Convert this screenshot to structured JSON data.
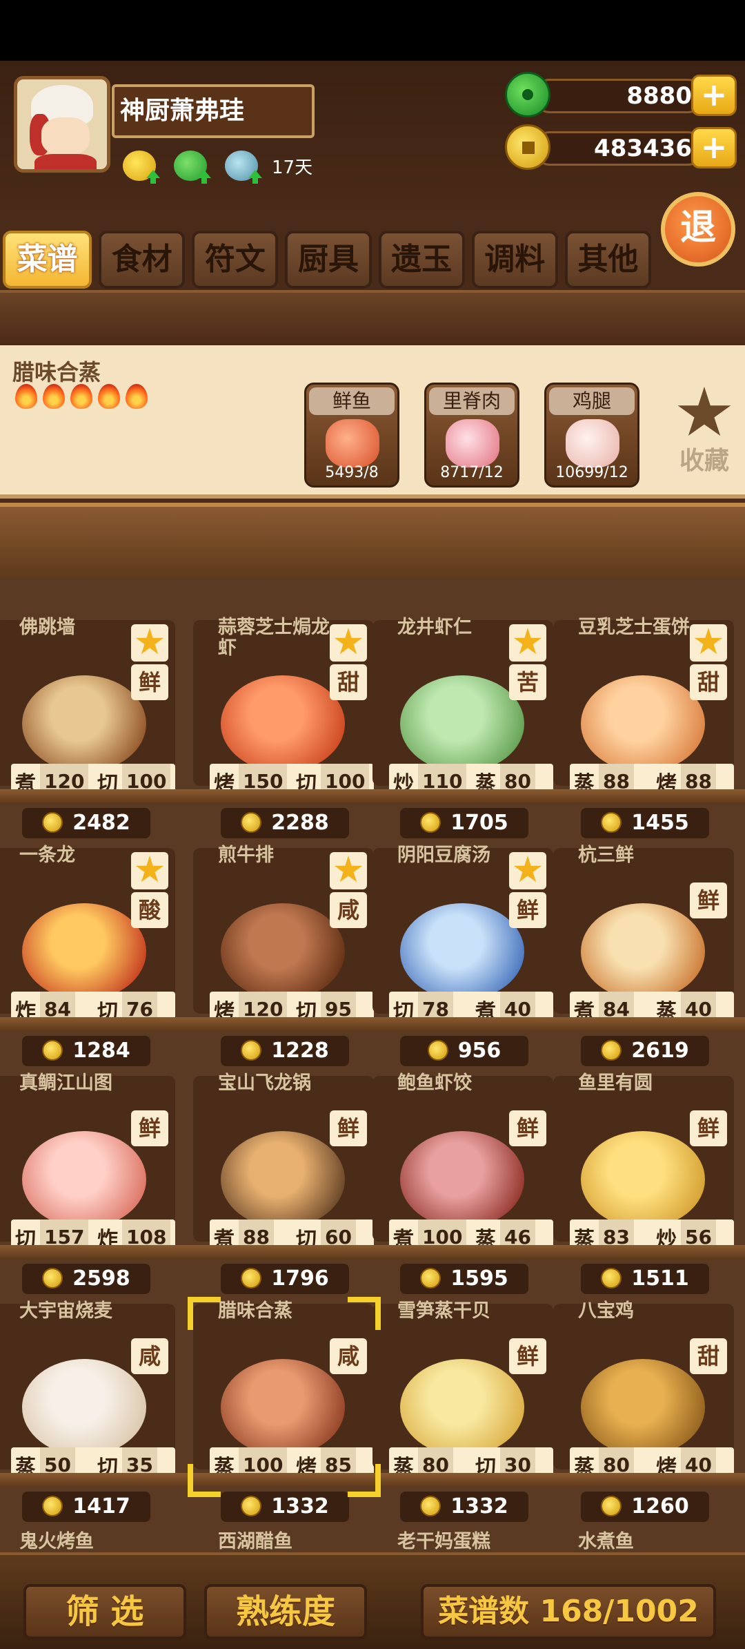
{
  "player": {
    "name": "神厨萧弗珪",
    "days": "17天"
  },
  "currency": {
    "jade": "8880",
    "gold": "483436",
    "plus": "+"
  },
  "exit_label": "退",
  "tabs": [
    "菜谱",
    "食材",
    "符文",
    "厨具",
    "遗玉",
    "调料",
    "其他"
  ],
  "selected_recipe": {
    "name": "腊味合蒸",
    "flames": 5,
    "ingredients": [
      {
        "name": "鲜鱼",
        "count": "5493/8"
      },
      {
        "name": "里脊肉",
        "count": "8717/12"
      },
      {
        "name": "鸡腿",
        "count": "10699/12"
      }
    ],
    "collect_label": "收藏"
  },
  "recipes": [
    {
      "name": "佛跳墙",
      "fav": true,
      "taste": "鲜",
      "s1": "煮",
      "v1": "120",
      "s2": "切",
      "v2": "100",
      "price": "2482"
    },
    {
      "name": "蒜蓉芝士焗龙虾",
      "fav": true,
      "taste": "甜",
      "s1": "烤",
      "v1": "150",
      "s2": "切",
      "v2": "100",
      "price": "2288"
    },
    {
      "name": "龙井虾仁",
      "fav": true,
      "taste": "苦",
      "s1": "炒",
      "v1": "110",
      "s2": "蒸",
      "v2": "80",
      "price": "1705"
    },
    {
      "name": "豆乳芝士蛋饼",
      "fav": true,
      "taste": "甜",
      "s1": "蒸",
      "v1": "88",
      "s2": "烤",
      "v2": "88",
      "price": "1455"
    },
    {
      "name": "一条龙",
      "fav": true,
      "taste": "酸",
      "s1": "炸",
      "v1": "84",
      "s2": "切",
      "v2": "76",
      "price": "1284"
    },
    {
      "name": "煎牛排",
      "fav": true,
      "taste": "咸",
      "s1": "烤",
      "v1": "120",
      "s2": "切",
      "v2": "95",
      "price": "1228"
    },
    {
      "name": "阴阳豆腐汤",
      "fav": true,
      "taste": "鲜",
      "s1": "切",
      "v1": "78",
      "s2": "煮",
      "v2": "40",
      "price": "956"
    },
    {
      "name": "杭三鲜",
      "fav": false,
      "taste": "鲜",
      "s1": "煮",
      "v1": "84",
      "s2": "蒸",
      "v2": "40",
      "price": "2619"
    },
    {
      "name": "真鲷江山图",
      "fav": false,
      "taste": "鲜",
      "s1": "切",
      "v1": "157",
      "s2": "炸",
      "v2": "108",
      "price": "2598"
    },
    {
      "name": "宝山飞龙锅",
      "fav": false,
      "taste": "鲜",
      "s1": "煮",
      "v1": "88",
      "s2": "切",
      "v2": "60",
      "price": "1796"
    },
    {
      "name": "鲍鱼虾饺",
      "fav": false,
      "taste": "鲜",
      "s1": "煮",
      "v1": "100",
      "s2": "蒸",
      "v2": "46",
      "price": "1595"
    },
    {
      "name": "鱼里有圆",
      "fav": false,
      "taste": "鲜",
      "s1": "蒸",
      "v1": "83",
      "s2": "炒",
      "v2": "56",
      "price": "1511"
    },
    {
      "name": "大宇宙烧麦",
      "fav": false,
      "taste": "咸",
      "s1": "蒸",
      "v1": "50",
      "s2": "切",
      "v2": "35",
      "price": "1417"
    },
    {
      "name": "腊味合蒸",
      "fav": false,
      "taste": "咸",
      "s1": "蒸",
      "v1": "100",
      "s2": "烤",
      "v2": "85",
      "price": "1332"
    },
    {
      "name": "雪笋蒸干贝",
      "fav": false,
      "taste": "鲜",
      "s1": "蒸",
      "v1": "80",
      "s2": "切",
      "v2": "30",
      "price": "1332"
    },
    {
      "name": "八宝鸡",
      "fav": false,
      "taste": "甜",
      "s1": "蒸",
      "v1": "80",
      "s2": "烤",
      "v2": "40",
      "price": "1260"
    }
  ],
  "next_row": [
    "鬼火烤鱼",
    "西湖醋鱼",
    "老干妈蛋糕",
    "水煮鱼"
  ],
  "bottom": {
    "filter": "筛 选",
    "mastery": "熟练度",
    "count": "菜谱数 168/1002"
  },
  "colors": {
    "wood_dark": "#4a2a18",
    "wood_light": "#8a5a30",
    "accent_gold": "#f6c842",
    "tab_active": "#f3b632",
    "panel_cream": "#f4e2c0",
    "selection": "#f6d02a"
  }
}
